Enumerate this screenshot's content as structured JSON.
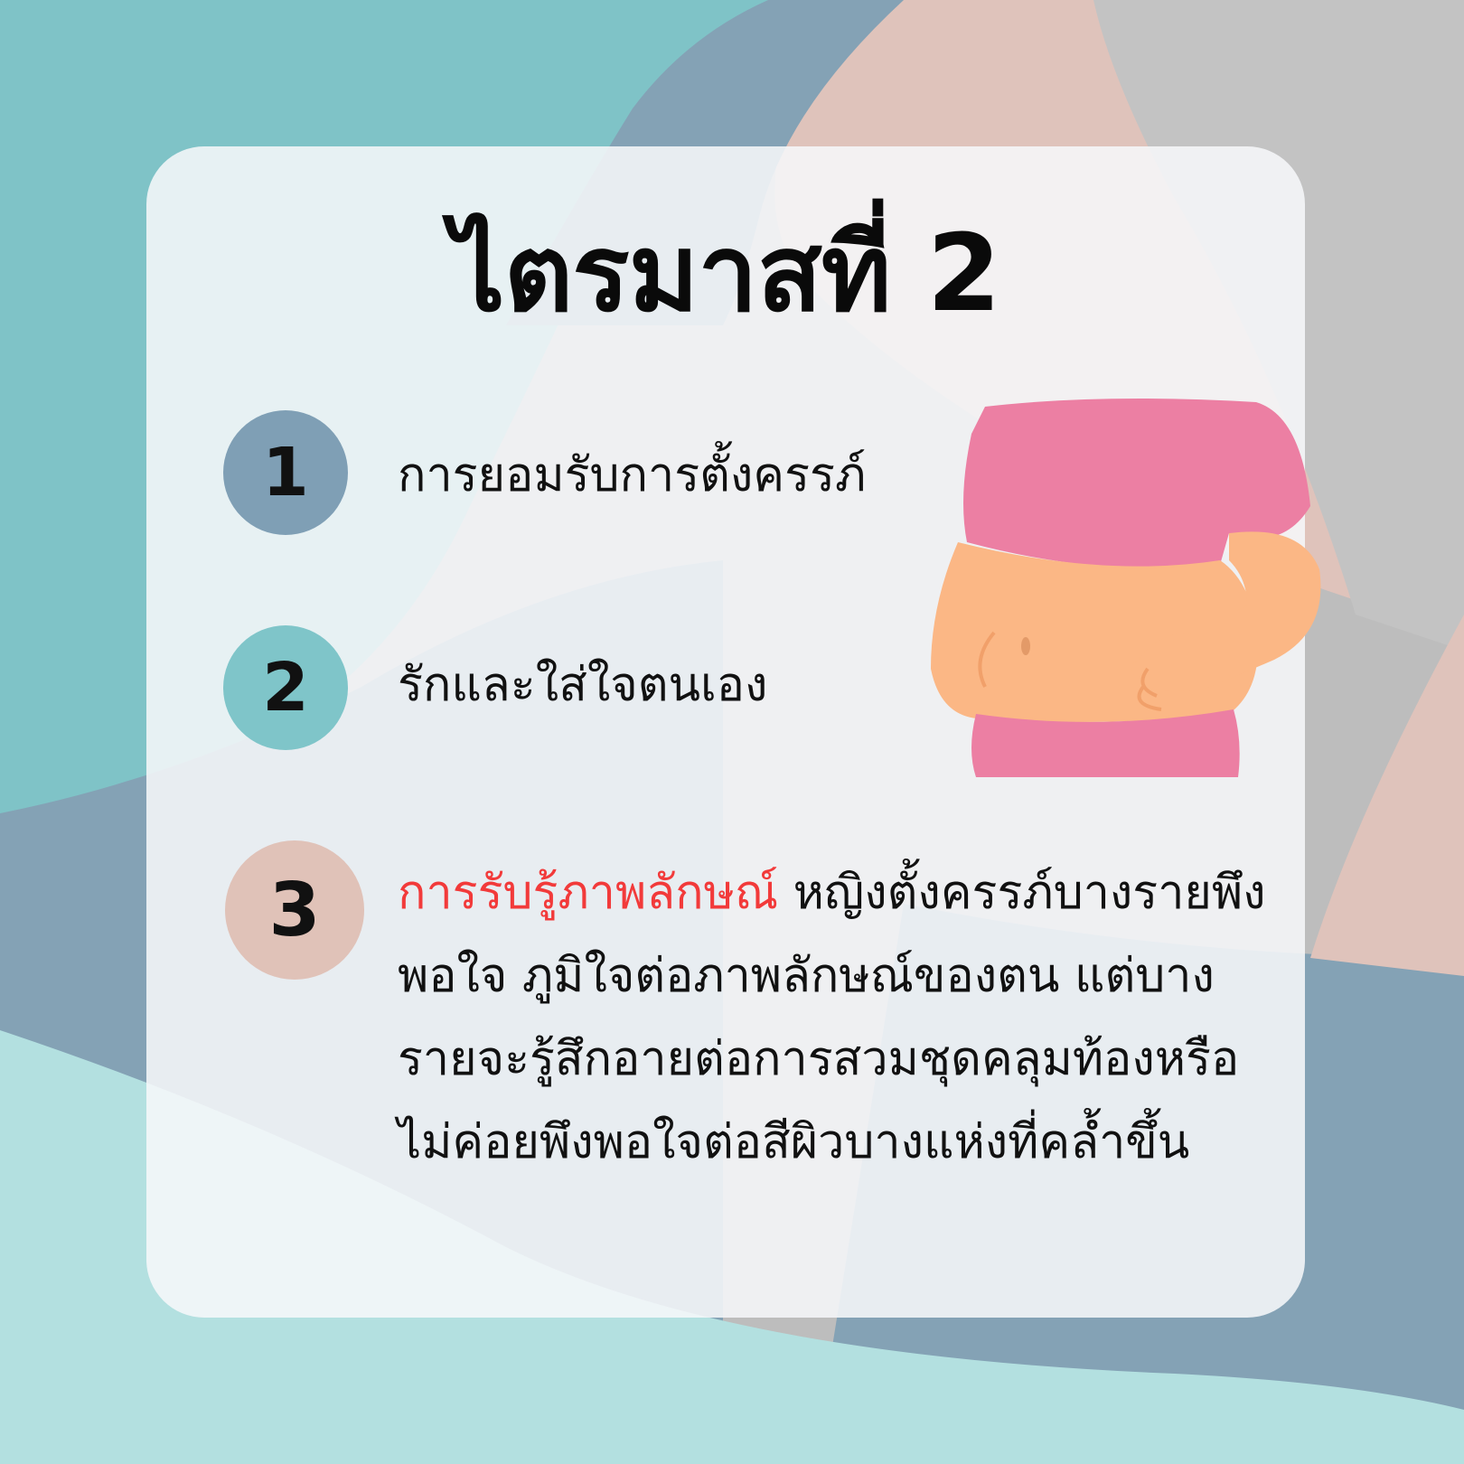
{
  "title": "ไตรมาสที่ 2",
  "items": [
    {
      "number": "1",
      "text": "การยอมรับการตั้งครรภ์"
    },
    {
      "number": "2",
      "text": "รักและใส่ใจตนเอง"
    },
    {
      "number": "3",
      "highlight": "การรับรู้ภาพลักษณ์",
      "text": " หญิงตั้งครรภ์บางรายพึงพอใจ ภูมิใจต่อภาพลักษณ์ของตน แต่บางรายจะรู้สึกอายต่อการสวมชุดคลุมท้องหรือไม่ค่อยพึงพอใจต่อสีผิวบางแห่งที่คล้ำขึ้น"
    }
  ],
  "colors": {
    "highlight": "#f23a3a",
    "circle_1": "#7f9fb5",
    "circle_2": "#7fc5c9",
    "circle_3": "#e0c2b8"
  },
  "illustration": "pregnant-belly-icon"
}
